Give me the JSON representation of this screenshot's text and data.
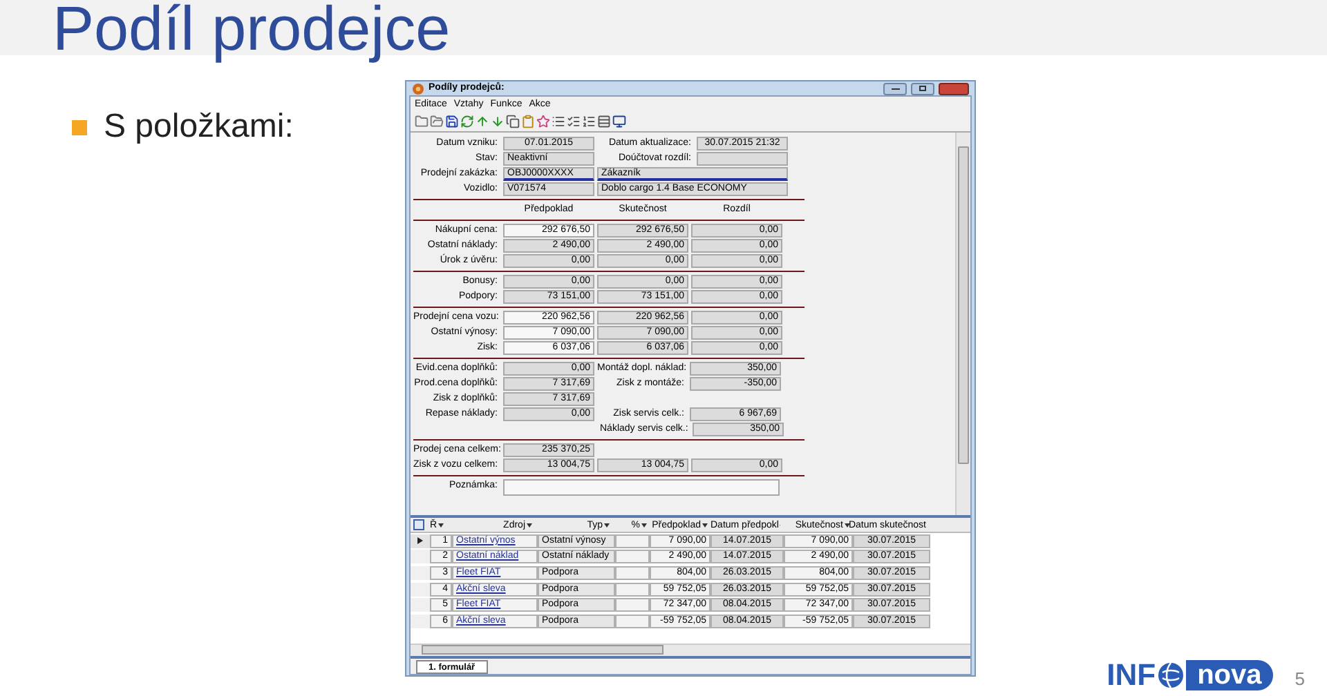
{
  "slide": {
    "title": "Podíl prodejce",
    "bullets": [
      "S položkami:"
    ],
    "logo": {
      "left": "INF",
      "right": "nova"
    },
    "page_number": "5"
  },
  "window": {
    "title": "Podíly prodejců:",
    "menu": [
      "Editace",
      "Vztahy",
      "Funkce",
      "Akce"
    ],
    "header_rows": [
      [
        {
          "label": "Datum vzniku:",
          "value": "07.01.2015",
          "kind": "date"
        },
        {
          "label": "Datum aktualizace:",
          "value": "30.07.2015 21:32",
          "kind": "date"
        }
      ],
      [
        {
          "label": "Stav:",
          "value": "Neaktivní",
          "kind": "text"
        },
        {
          "label": "Doúčtovat rozdíl:",
          "kind": "text"
        }
      ],
      [
        {
          "label": "Prodejní zakázka:",
          "value": "OBJ0000XXXX",
          "kind": "lookup"
        },
        {
          "value": "Zákazník",
          "kind": "lookup"
        }
      ],
      [
        {
          "label": "Vozidlo:",
          "value": "V071574",
          "kind": "text"
        },
        {
          "value": "Doblo cargo 1.4 Base ECONOMY",
          "kind": "text"
        }
      ]
    ],
    "columns": [
      "Předpoklad",
      "Skutečnost",
      "Rozdíl"
    ],
    "sections": [
      {
        "kind": "triple",
        "rows": [
          {
            "label": "Nákupní cena:",
            "values": [
              "292 676,50",
              "292 676,50",
              "0,00"
            ],
            "editable": true
          },
          {
            "label": "Ostatní náklady:",
            "values": [
              "2 490,00",
              "2 490,00",
              "0,00"
            ],
            "editable": false
          },
          {
            "label": "Úrok z úvěru:",
            "values": [
              "0,00",
              "0,00",
              "0,00"
            ],
            "editable": false
          }
        ]
      },
      {
        "kind": "triple",
        "rows": [
          {
            "label": "Bonusy:",
            "values": [
              "0,00",
              "0,00",
              "0,00"
            ],
            "editable": false
          },
          {
            "label": "Podpory:",
            "values": [
              "73 151,00",
              "73 151,00",
              "0,00"
            ],
            "editable": false
          }
        ]
      },
      {
        "kind": "triple",
        "rows": [
          {
            "label": "Prodejní cena vozu:",
            "values": [
              "220 962,56",
              "220 962,56",
              "0,00"
            ],
            "editable": true
          },
          {
            "label": "Ostatní výnosy:",
            "values": [
              "7 090,00",
              "7 090,00",
              "0,00"
            ],
            "editable": true
          },
          {
            "label": "Zisk:",
            "values": [
              "6 037,06",
              "6 037,06",
              "0,00"
            ],
            "editable": true
          }
        ]
      },
      {
        "kind": "pairs",
        "rows": [
          {
            "left": {
              "label": "Evid.cena doplňků:",
              "value": "0,00"
            },
            "right": {
              "label": "Montáž dopl. náklad:",
              "value": "350,00"
            }
          },
          {
            "left": {
              "label": "Prod.cena doplňků:",
              "value": "7 317,69"
            },
            "right": {
              "label": "Zisk z montáže:",
              "value": "-350,00"
            }
          },
          {
            "left": {
              "label": "Zisk z doplňků:",
              "value": "7 317,69"
            }
          },
          {
            "left": {
              "label": "Repase náklady:",
              "value": "0,00"
            },
            "right": {
              "label": "Zisk servis celk.:",
              "value": "6 967,69"
            }
          },
          {
            "right": {
              "label": "Náklady servis celk.:",
              "value": "350,00"
            }
          }
        ]
      },
      {
        "kind": "triple",
        "rows": [
          {
            "label": "Prodej cena celkem:",
            "values": [
              "235 370,25"
            ],
            "editable": false
          },
          {
            "label": "Zisk z vozu celkem:",
            "values": [
              "13 004,75",
              "13 004,75",
              "0,00"
            ],
            "editable": false
          }
        ]
      }
    ],
    "note_label": "Poznámka:",
    "grid": {
      "columns": [
        "Ř",
        "Zdroj",
        "Typ",
        "%",
        "Předpoklad",
        "Datum předpokl",
        "Skutečnost",
        "Datum skutečnost"
      ],
      "rows": [
        {
          "n": "1",
          "source": "Ostatní výnos",
          "type": "Ostatní výnosy",
          "planned": "7 090,00",
          "planned_date": "14.07.2015",
          "actual": "7 090,00",
          "actual_date": "30.07.2015",
          "selected": true
        },
        {
          "n": "2",
          "source": "Ostatní náklad",
          "type": "Ostatní náklady",
          "planned": "2 490,00",
          "planned_date": "14.07.2015",
          "actual": "2 490,00",
          "actual_date": "30.07.2015",
          "selected": false
        },
        {
          "n": "3",
          "source": "Fleet FIAT",
          "type": "Podpora",
          "planned": "804,00",
          "planned_date": "26.03.2015",
          "actual": "804,00",
          "actual_date": "30.07.2015",
          "selected": false
        },
        {
          "n": "4",
          "source": "Akční sleva",
          "type": "Podpora",
          "planned": "59 752,05",
          "planned_date": "26.03.2015",
          "actual": "59 752,05",
          "actual_date": "30.07.2015",
          "selected": false
        },
        {
          "n": "5",
          "source": "Fleet FIAT",
          "type": "Podpora",
          "planned": "72 347,00",
          "planned_date": "08.04.2015",
          "actual": "72 347,00",
          "actual_date": "30.07.2015",
          "selected": false
        },
        {
          "n": "6",
          "source": "Akční sleva",
          "type": "Podpora",
          "planned": "-59 752,05",
          "planned_date": "08.04.2015",
          "actual": "-59 752,05",
          "actual_date": "30.07.2015",
          "selected": false
        }
      ]
    },
    "tabs": [
      {
        "label": "1. formulář",
        "selected": true
      }
    ]
  }
}
